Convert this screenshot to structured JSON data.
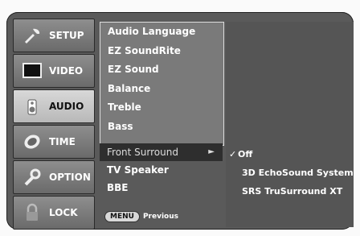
{
  "sidebar": {
    "items": [
      {
        "label": "SETUP",
        "icon": "setup-icon",
        "active": false
      },
      {
        "label": "VIDEO",
        "icon": "video-icon",
        "active": false
      },
      {
        "label": "AUDIO",
        "icon": "audio-icon",
        "active": true
      },
      {
        "label": "TIME",
        "icon": "time-icon",
        "active": false
      },
      {
        "label": "OPTION",
        "icon": "option-icon",
        "active": false
      },
      {
        "label": "LOCK",
        "icon": "lock-icon",
        "active": false
      }
    ]
  },
  "menu": {
    "items": [
      {
        "label": "Audio Language"
      },
      {
        "label": "EZ SoundRite"
      },
      {
        "label": "EZ Sound"
      },
      {
        "label": "Balance"
      },
      {
        "label": "Treble"
      },
      {
        "label": "Bass"
      }
    ],
    "lower_items": [
      {
        "label": "Front Surround",
        "arrow": "►",
        "selected": true
      },
      {
        "label": "TV Speaker"
      },
      {
        "label": "BBE"
      }
    ],
    "footer": {
      "button": "MENU",
      "text": "Previous"
    }
  },
  "submenu": {
    "options": [
      {
        "label": "Off",
        "check": "✓"
      },
      {
        "label": "3D EchoSound System"
      },
      {
        "label": "SRS TruSurround XT"
      }
    ]
  }
}
